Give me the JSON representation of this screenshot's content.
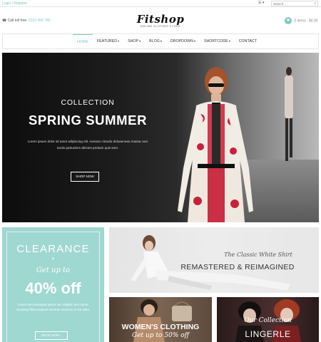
{
  "topbar": {
    "login_label": "Login / Register",
    "account_label": "☰ ▾",
    "search_placeholder": "Search...",
    "search_icon": "⌕"
  },
  "header": {
    "phone_prefix": "☎  Call toll free:",
    "phone_number": "0123 456 789",
    "logo_word": "Fitshop",
    "logo_tagline": "ONLINE CLOTHES STORE",
    "cart_icon": "✖",
    "cart_label": "0 items - $0.00"
  },
  "nav": {
    "items": [
      {
        "label": "HOME",
        "dropdown": ""
      },
      {
        "label": "FEATURED",
        "dropdown": "▾"
      },
      {
        "label": "SHOP",
        "dropdown": "▾"
      },
      {
        "label": "BLOG",
        "dropdown": "▾"
      },
      {
        "label": "DROPDOWN",
        "dropdown": "▾"
      },
      {
        "label": "SHORTCODE",
        "dropdown": "▾"
      },
      {
        "label": "CONTACT",
        "dropdown": ""
      }
    ]
  },
  "hero": {
    "eyebrow": "COLLECTION",
    "title": "SPRING SUMMER",
    "text": "Lorem ipsum dolor sit amet adipiscing elit. Aenean cimodo doloaenean massa cum sociis parturient ultricies pretium quis sem.",
    "button_label": "SHOP NOW"
  },
  "promo_clearance": {
    "title": "CLEARANCE",
    "divider": "✶",
    "subtitle": "Get up to",
    "amount": "40% off",
    "text": "Lorem elit consequat ipsum nec sagittis sem nauric sociosqu fibra torquent mentum nostroso in est diam.",
    "button_label": "SHOP NOW  ›"
  },
  "promo_shirt": {
    "script": "The Classic White Shirt",
    "title": "REMASTERED & REIMAGINED"
  },
  "promo_women": {
    "title": "WOMEN'S CLOTHING",
    "subtitle": "Get up to 50% off"
  },
  "promo_lingerie": {
    "script": "Our Collection",
    "title": "LINGERLE"
  },
  "colors": {
    "accent": "#7ec9c2",
    "clearance_bg": "#9fd7d1"
  }
}
